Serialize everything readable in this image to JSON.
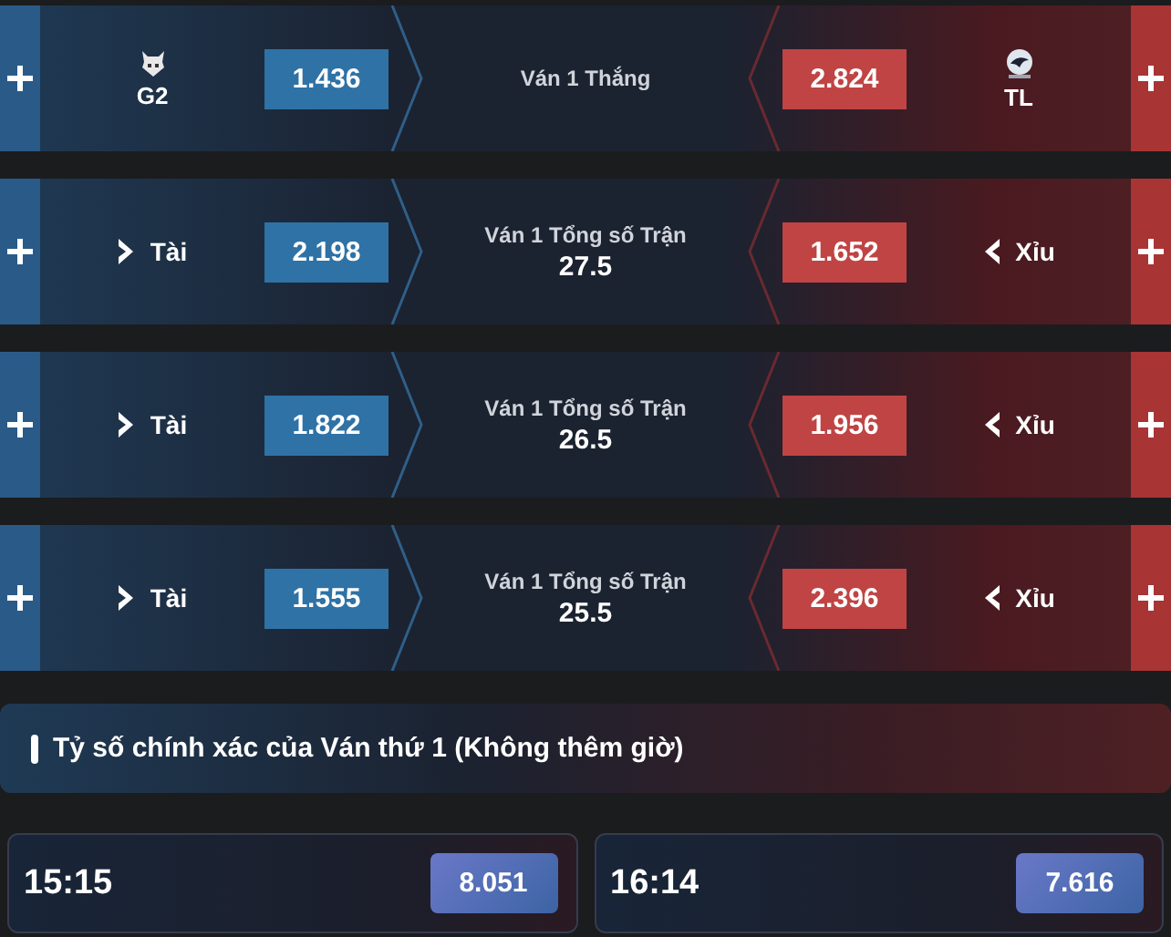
{
  "markets": [
    {
      "kind": "team",
      "left": {
        "label": "G2",
        "odds": "1.436"
      },
      "title": "Ván 1 Thắng",
      "right": {
        "label": "TL",
        "odds": "2.824"
      }
    },
    {
      "kind": "option",
      "left": {
        "label": "Tài",
        "odds": "2.198"
      },
      "title": "Ván 1 Tổng số Trận",
      "line": "27.5",
      "right": {
        "label": "Xỉu",
        "odds": "1.652"
      }
    },
    {
      "kind": "option",
      "left": {
        "label": "Tài",
        "odds": "1.822"
      },
      "title": "Ván 1 Tổng số Trận",
      "line": "26.5",
      "right": {
        "label": "Xỉu",
        "odds": "1.956"
      }
    },
    {
      "kind": "option",
      "left": {
        "label": "Tài",
        "odds": "1.555"
      },
      "title": "Ván 1 Tổng số Trận",
      "line": "25.5",
      "right": {
        "label": "Xỉu",
        "odds": "2.396"
      }
    }
  ],
  "section": {
    "title": "Tỷ số chính xác của Ván thứ 1 (Không thêm giờ)"
  },
  "scores": [
    {
      "score": "15:15",
      "odds": "8.051"
    },
    {
      "score": "16:14",
      "odds": "7.616"
    }
  ]
}
